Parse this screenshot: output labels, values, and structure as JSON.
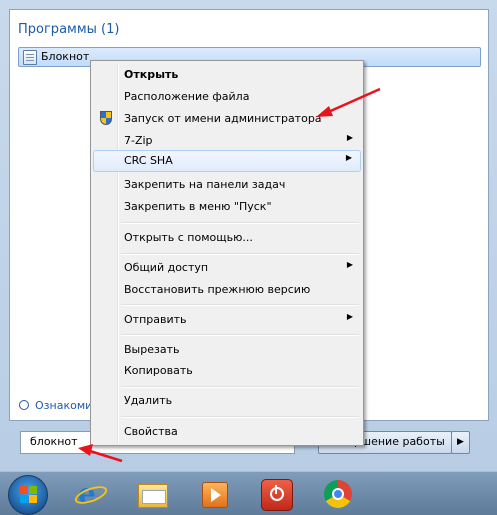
{
  "start_menu": {
    "heading": "Программы (1)",
    "result_item": {
      "label": "Блокнот",
      "icon": "notepad-icon"
    },
    "see_more": "Ознакоми",
    "search": {
      "value": "блокнот",
      "clear_glyph": "✕"
    },
    "shutdown": {
      "label": "Завершение работы",
      "arrow": "▶"
    }
  },
  "context_menu": {
    "items": [
      {
        "label": "Открыть",
        "bold": true
      },
      {
        "label": "Расположение файла"
      },
      {
        "label": "Запуск от имени администратора",
        "icon": "uac-shield-icon"
      },
      {
        "label": "7-Zip",
        "submenu": true
      },
      {
        "label": "CRC SHA",
        "submenu": true,
        "highlighted": true
      },
      {
        "label": "Закрепить на панели задач"
      },
      {
        "label": "Закрепить в меню \"Пуск\""
      },
      {
        "label": "Открыть с помощью..."
      },
      {
        "label": "Общий доступ",
        "submenu": true
      },
      {
        "label": "Восстановить прежнюю версию"
      },
      {
        "label": "Отправить",
        "submenu": true
      },
      {
        "label": "Вырезать"
      },
      {
        "label": "Копировать"
      },
      {
        "label": "Удалить"
      },
      {
        "label": "Свойства"
      }
    ],
    "submenu_glyph": "▶"
  },
  "taskbar": {
    "icons": [
      "windows-start-orb-icon",
      "internet-explorer-icon",
      "windows-explorer-icon",
      "media-player-icon",
      "power-app-icon",
      "chrome-icon"
    ]
  },
  "colors": {
    "annotation_arrow": "#e8141b",
    "highlight_border": "#aecff7",
    "heading": "#1e5aa8"
  }
}
